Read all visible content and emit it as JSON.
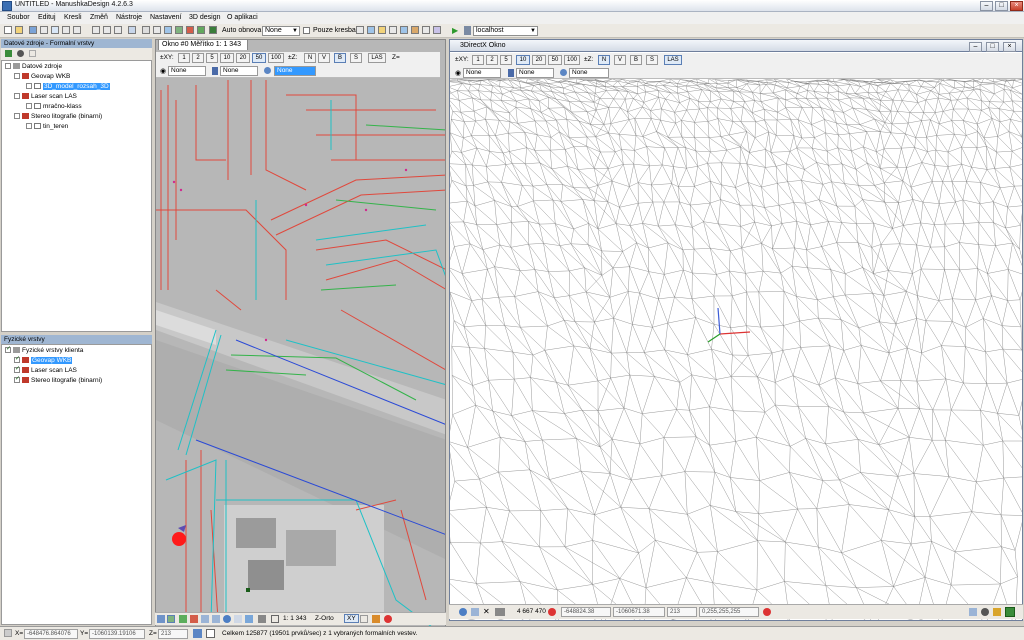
{
  "window": {
    "title": "UNTITLED - ManushkaDesign 4.2.6.3"
  },
  "menu": [
    "Soubor",
    "Edituj",
    "Kresli",
    "Změň",
    "Nástroje",
    "Nastavení",
    "3D design",
    "O aplikaci"
  ],
  "toolbar": {
    "auto_refresh_label": "Auto obnova",
    "mode_combo": "None",
    "only_drawing_label": "Pouze kresba",
    "server_combo": "localhost"
  },
  "left_top_panel": {
    "title": "Datové zdroje - Formalní vrstvy",
    "items": [
      {
        "label": "Datové zdroje"
      },
      {
        "label": "Geovap WKB"
      },
      {
        "label": "3D_model_rozsah_3D"
      },
      {
        "label": "Laser scan LAS"
      },
      {
        "label": "mračno-klass"
      },
      {
        "label": "Stereo litografie (binarni)"
      },
      {
        "label": "tin_teren"
      }
    ]
  },
  "left_bottom_panel": {
    "title": "Fyzické vrstvy",
    "items": [
      {
        "label": "Fyzické vrstvy klienta"
      },
      {
        "label": "Geovap WKB"
      },
      {
        "label": "Laser scan LAS"
      },
      {
        "label": "Stereo litografie (binarni)"
      }
    ]
  },
  "view2d": {
    "tab_title": "Okno #0 Měřítko 1: 1 343",
    "xy_label": "±XY:",
    "scales": [
      "1",
      "2",
      "5",
      "10",
      "20",
      "50",
      "100"
    ],
    "z_label": "±Z:",
    "toggles": [
      "N",
      "V",
      "B",
      "S"
    ],
    "las_label": "LAS",
    "z_extra": "Z=",
    "combos": [
      "None",
      "None",
      "None"
    ],
    "bottom": {
      "scale": "1: 1 343",
      "mode": "Z-Orto",
      "xy": "XY"
    }
  },
  "view3d": {
    "title": "3DirectX Okno",
    "xy_label": "±XY:",
    "scales": [
      "1",
      "2",
      "5",
      "10",
      "20",
      "50",
      "100"
    ],
    "z_label": "±Z:",
    "toggles": [
      "N",
      "V",
      "B",
      "S"
    ],
    "las_label": "LAS",
    "combos": [
      "None",
      "None",
      "None"
    ],
    "bottom": {
      "value": "4 667 470",
      "x_field": "-648824.38",
      "y_field": "-1060671.38",
      "z_field": "213",
      "rgb_field": "0,255,255,255"
    }
  },
  "statusbar": {
    "x_label": "X=",
    "x_value": "-648476.864076",
    "y_label": "Y=",
    "y_value": "-1060139.19106",
    "z_label": "Z=",
    "z_value": "213",
    "message": "Celkem 125877 (19501 prvků/sec) z 1 vybraných formalních vestev."
  }
}
